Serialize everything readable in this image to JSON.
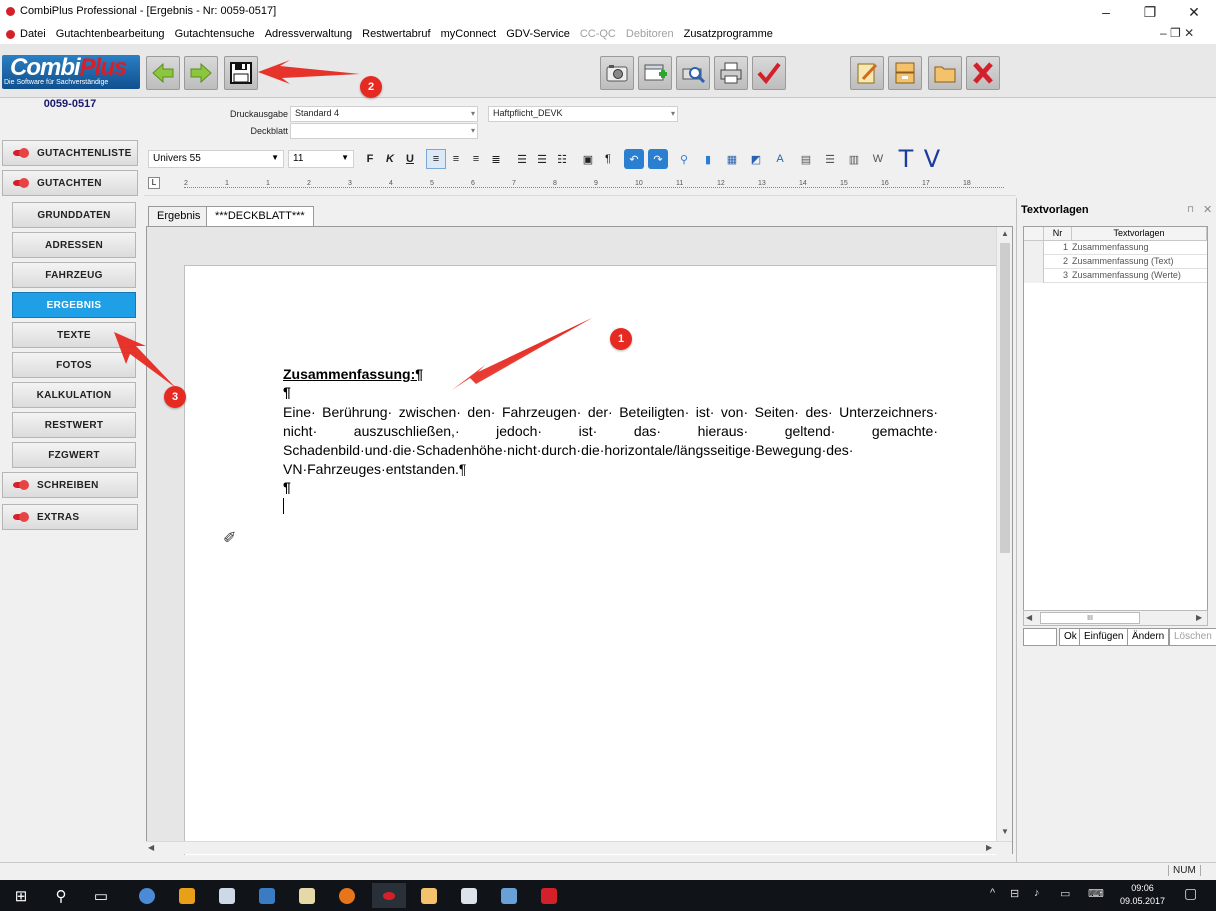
{
  "window": {
    "title": "CombiPlus Professional - [Ergebnis - Nr: 0059-0517]",
    "minimize": "–",
    "maximize": "❐",
    "close": "✕"
  },
  "menu": {
    "items": [
      {
        "label": "Datei",
        "enabled": true
      },
      {
        "label": "Gutachtenbearbeitung",
        "enabled": true
      },
      {
        "label": "Gutachtensuche",
        "enabled": true
      },
      {
        "label": "Adressverwaltung",
        "enabled": true
      },
      {
        "label": "Restwertabruf",
        "enabled": true
      },
      {
        "label": "myConnect",
        "enabled": true
      },
      {
        "label": "GDV-Service",
        "enabled": true
      },
      {
        "label": "CC-QC",
        "enabled": false
      },
      {
        "label": "Debitoren",
        "enabled": false
      },
      {
        "label": "Zusatzprogramme",
        "enabled": true
      }
    ],
    "mdi_controls": "– ❐ ✕"
  },
  "logo": {
    "brand_a": "Combi",
    "brand_b": "Plus",
    "tagline": "Die Software für Sachverständige"
  },
  "case_number": "0059-0517",
  "toolbar_icons": [
    "back-arrow-icon",
    "forward-arrow-icon",
    "save-icon",
    "camera-icon",
    "add-icon",
    "print-preview-icon",
    "printer-icon",
    "checkmark-icon",
    "edit-icon",
    "archive-icon",
    "folder-icon",
    "delete-icon"
  ],
  "nav": {
    "items": [
      {
        "label": "GUTACHTENLISTE",
        "group": true,
        "active": false
      },
      {
        "label": "GUTACHTEN",
        "group": true,
        "active": false
      },
      {
        "label": "GRUNDDATEN",
        "group": false,
        "active": false
      },
      {
        "label": "ADRESSEN",
        "group": false,
        "active": false
      },
      {
        "label": "FAHRZEUG",
        "group": false,
        "active": false
      },
      {
        "label": "ERGEBNIS",
        "group": false,
        "active": true
      },
      {
        "label": "TEXTE",
        "group": false,
        "active": false
      },
      {
        "label": "FOTOS",
        "group": false,
        "active": false
      },
      {
        "label": "KALKULATION",
        "group": false,
        "active": false
      },
      {
        "label": "RESTWERT",
        "group": false,
        "active": false
      },
      {
        "label": "FZGWERT",
        "group": false,
        "active": false
      },
      {
        "label": "SCHREIBEN",
        "group": true,
        "active": false
      },
      {
        "label": "EXTRAS",
        "group": true,
        "active": false
      }
    ]
  },
  "form": {
    "druckausgabe_label": "Druckausgabe",
    "druckausgabe_value": "Standard 4",
    "haftpflicht_value": "Haftpflicht_DEVK",
    "deckblatt_label": "Deckblatt",
    "deckblatt_value": ""
  },
  "format": {
    "font_name": "Univers 55",
    "font_size": "11",
    "bold": "F",
    "italic": "K",
    "underline": "U"
  },
  "ruler": {
    "numbers": [
      "2",
      "1",
      "1",
      "2",
      "3",
      "4",
      "5",
      "6",
      "7",
      "8",
      "9",
      "10",
      "11",
      "12",
      "13",
      "14",
      "15",
      "16",
      "17",
      "18"
    ]
  },
  "tabs": [
    {
      "label": "Ergebnis",
      "active": false
    },
    {
      "label": "***DECKBLATT***",
      "active": true
    }
  ],
  "document": {
    "heading": "Zusammenfassung:¶",
    "pilcrow": "¶",
    "body": "Eine· Berührung· zwischen· den· Fahrzeugen· der· Beteiligten· ist· von· Seiten· des· Unterzeichners· nicht· auszuschließen,· jedoch· ist· das· hieraus· geltend· gemachte· Schadenbild·und·die·Schadenhöhe·nicht·durch·die·horizontale/längsseitige·Bewegung·des· VN·Fahrzeuges·entstanden.¶",
    "pilcrow2": "¶"
  },
  "textvorlagen": {
    "title": "Textvorlagen",
    "pin": "⊓",
    "close": "✕",
    "col_nr": "Nr",
    "col_text": "Textvorlagen",
    "rows": [
      {
        "nr": "1",
        "text": "Zusammenfassung"
      },
      {
        "nr": "2",
        "text": "Zusammenfassung (Text)"
      },
      {
        "nr": "3",
        "text": "Zusammenfassung (Werte)"
      }
    ],
    "scroll_mark": "III",
    "btn_ok": "Ok",
    "btn_insert": "Einfügen",
    "btn_change": "Ändern",
    "btn_delete": "Löschen"
  },
  "status": {
    "num": "NUM"
  },
  "taskbar": {
    "time": "09:06",
    "date": "09.05.2017"
  },
  "annotations": [
    {
      "number": "1"
    },
    {
      "number": "2"
    },
    {
      "number": "3"
    }
  ],
  "colors": {
    "accent_active": "#1f9fe6",
    "annotation_red": "#e62a22",
    "brand_red": "#d4202a",
    "brand_blue": "#11508e"
  }
}
